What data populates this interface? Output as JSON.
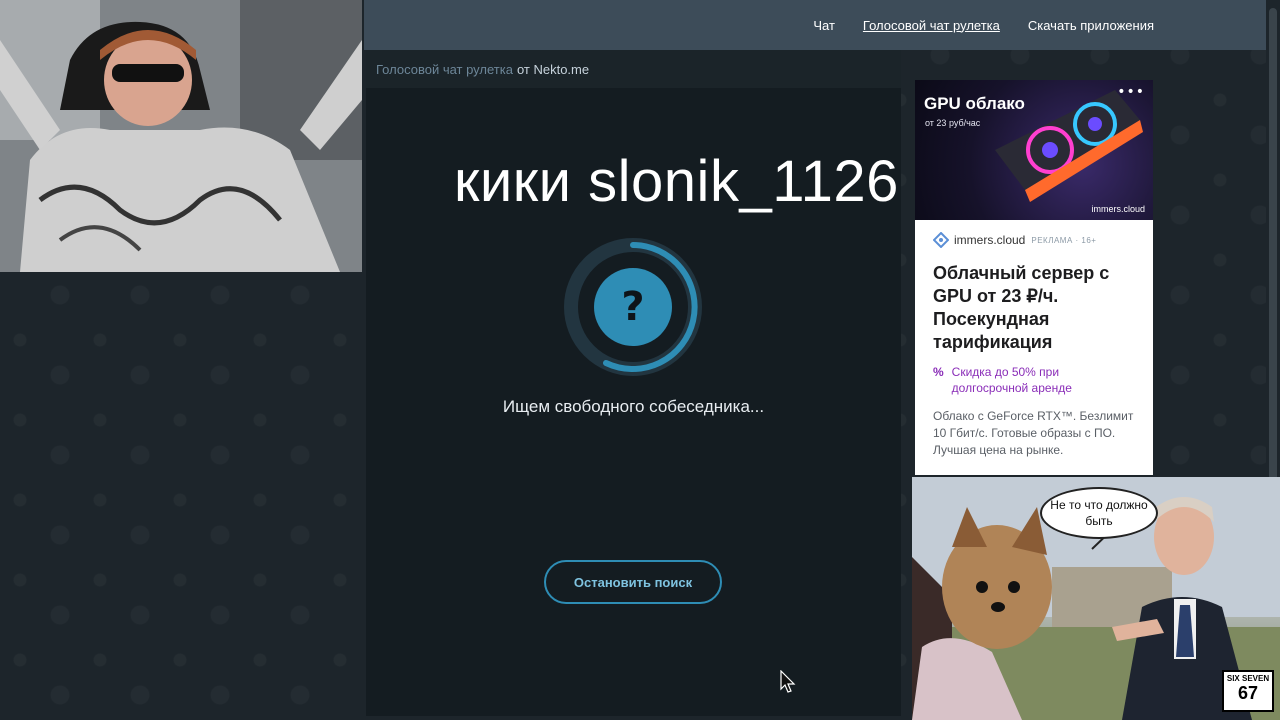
{
  "nav": {
    "items": [
      {
        "label": "Чат",
        "active": false
      },
      {
        "label": "Голосовой чат рулетка",
        "active": true
      },
      {
        "label": "Скачать приложения",
        "active": false
      }
    ]
  },
  "chat": {
    "header_link": "Голосовой чат рулетка",
    "header_by": "от Nekto.me",
    "status_icon": "question-mark-icon",
    "status_symbol": "?",
    "status_text": "Ищем свободного собеседника...",
    "stop_button": "Остановить поиск"
  },
  "overlay": {
    "caption": "кики slonik_1126"
  },
  "ad": {
    "banner_title": "GPU облако",
    "banner_sub": "от 23 руб/час",
    "banner_brand": "immers.cloud",
    "menu_symbol": "•••",
    "brand": "immers.cloud",
    "mark": "РЕКЛАМА · 16+",
    "headline": "Облачный сервер с GPU от 23 ₽/ч. Посекундная тарификация",
    "promo_symbol": "%",
    "promo": "Скидка до 50% при долгосрочной аренде",
    "description": "Облако с GeForce RTX™. Безлимит 10 Гбит/с. Готовые образы с ПО. Лучшая цена на рынке."
  },
  "meme": {
    "speech": "Не то что должно быть",
    "badge_top": "SIX SEVEN",
    "badge_num": "67"
  },
  "colors": {
    "accent": "#2e8db5",
    "nav_bg": "#3d4c59",
    "panel_bg": "#141c21",
    "ad_promo": "#8a2db8"
  }
}
